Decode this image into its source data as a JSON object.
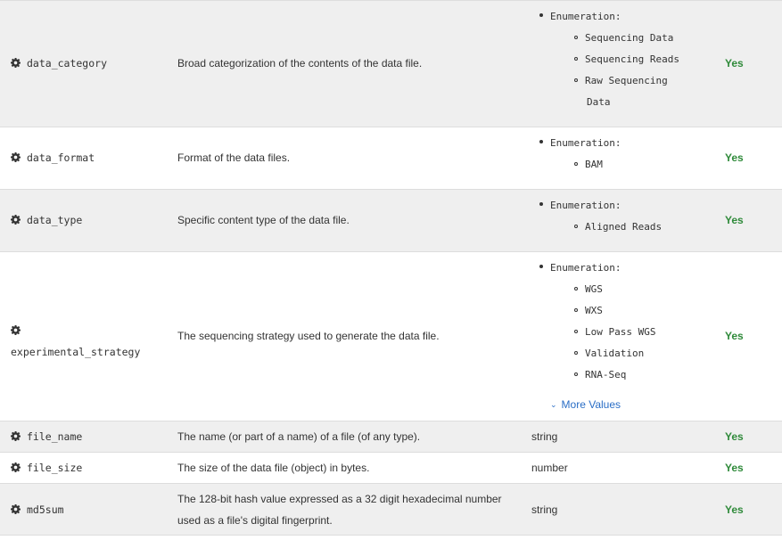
{
  "columns": [],
  "rows": [
    {
      "name": "data_category",
      "description": "Broad categorization of the contents of the data file.",
      "enumeration_label": "Enumeration:",
      "values": [
        "Sequencing Data",
        "Sequencing Reads",
        "Raw Sequencing",
        "Data"
      ],
      "required": "Yes"
    },
    {
      "name": "data_format",
      "description": "Format of the data files.",
      "enumeration_label": "Enumeration:",
      "values": [
        "BAM"
      ],
      "required": "Yes"
    },
    {
      "name": "data_type",
      "description": "Specific content type of the data file.",
      "enumeration_label": "Enumeration:",
      "values": [
        "Aligned Reads"
      ],
      "required": "Yes"
    },
    {
      "name": "experimental_strategy",
      "description": "The sequencing strategy used to generate the data file.",
      "enumeration_label": "Enumeration:",
      "values": [
        "WGS",
        "WXS",
        "Low Pass WGS",
        "Validation",
        "RNA-Seq"
      ],
      "more_label": "More Values",
      "required": "Yes"
    },
    {
      "name": "file_name",
      "description": "The name (or part of a name) of a file (of any type).",
      "type": "string",
      "required": "Yes"
    },
    {
      "name": "file_size",
      "description": "The size of the data file (object) in bytes.",
      "type": "number",
      "required": "Yes"
    },
    {
      "name": "md5sum",
      "description_lines": [
        "The 128-bit hash value expressed as a 32 digit hexadecimal number",
        "used as a file's digital fingerprint."
      ],
      "type": "string",
      "required": "Yes"
    }
  ],
  "icons": {
    "property": "gear-icon",
    "more": "chevron-down-icon"
  },
  "colors": {
    "required": "#2f8a3a",
    "link": "#2a6ec6",
    "row_alt": "#efefef",
    "border": "#dddddd"
  }
}
